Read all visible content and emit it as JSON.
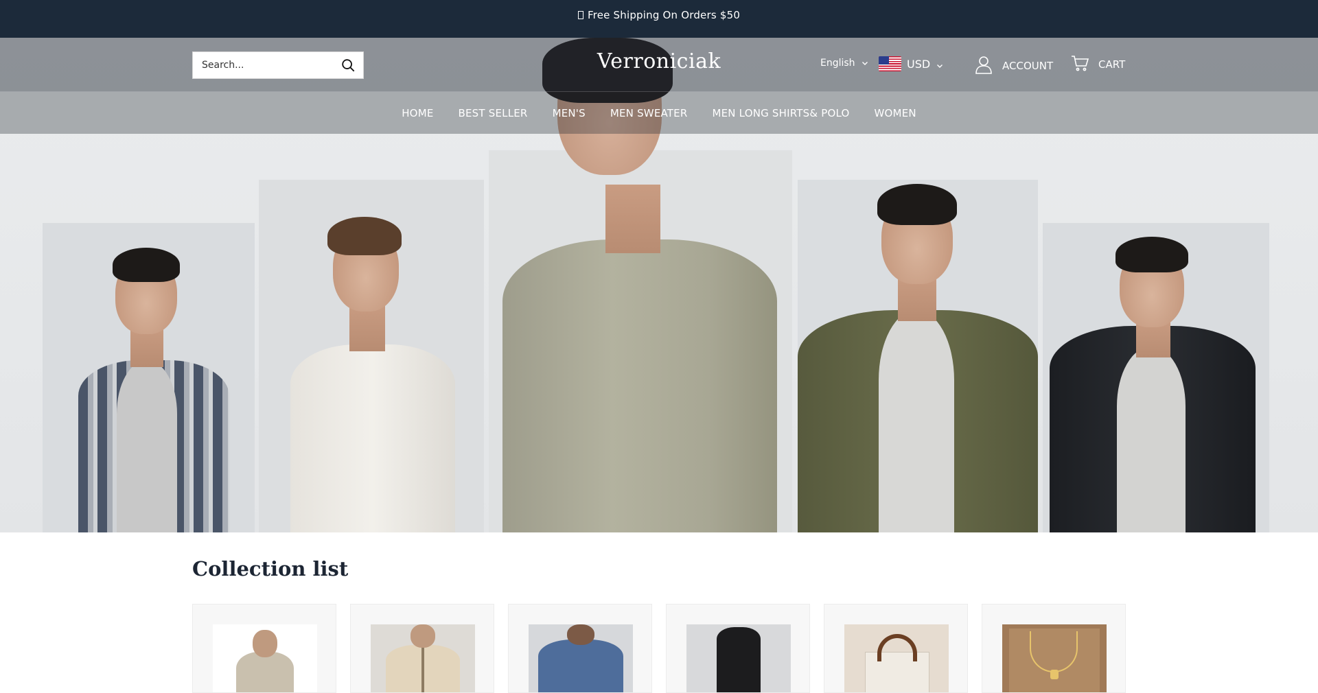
{
  "announcement": {
    "text": "Free Shipping On Orders $50"
  },
  "header": {
    "search_placeholder": "Search...",
    "logo": "Verroniciak",
    "language": "English",
    "currency": "USD",
    "account_label": "ACCOUNT",
    "cart_label": "CART"
  },
  "nav": {
    "items": [
      {
        "label": "HOME"
      },
      {
        "label": "BEST SELLER"
      },
      {
        "label": "MEN'S"
      },
      {
        "label": "MEN SWEATER"
      },
      {
        "label": "MEN LONG SHIRTS& POLO"
      },
      {
        "label": "WOMEN"
      }
    ]
  },
  "collection": {
    "title": "Collection list",
    "cards": [
      {
        "icon": "quarter-zip-sweater-thumbnail"
      },
      {
        "icon": "cardigan-thumbnail"
      },
      {
        "icon": "blue-tee-thumbnail"
      },
      {
        "icon": "black-dress-thumbnail"
      },
      {
        "icon": "handbag-thumbnail"
      },
      {
        "icon": "necklace-thumbnail"
      }
    ]
  },
  "colors": {
    "announcement_bg": "#1c2a3a",
    "text_dark": "#1c2533",
    "hero_bg": "#e8eaeb"
  }
}
